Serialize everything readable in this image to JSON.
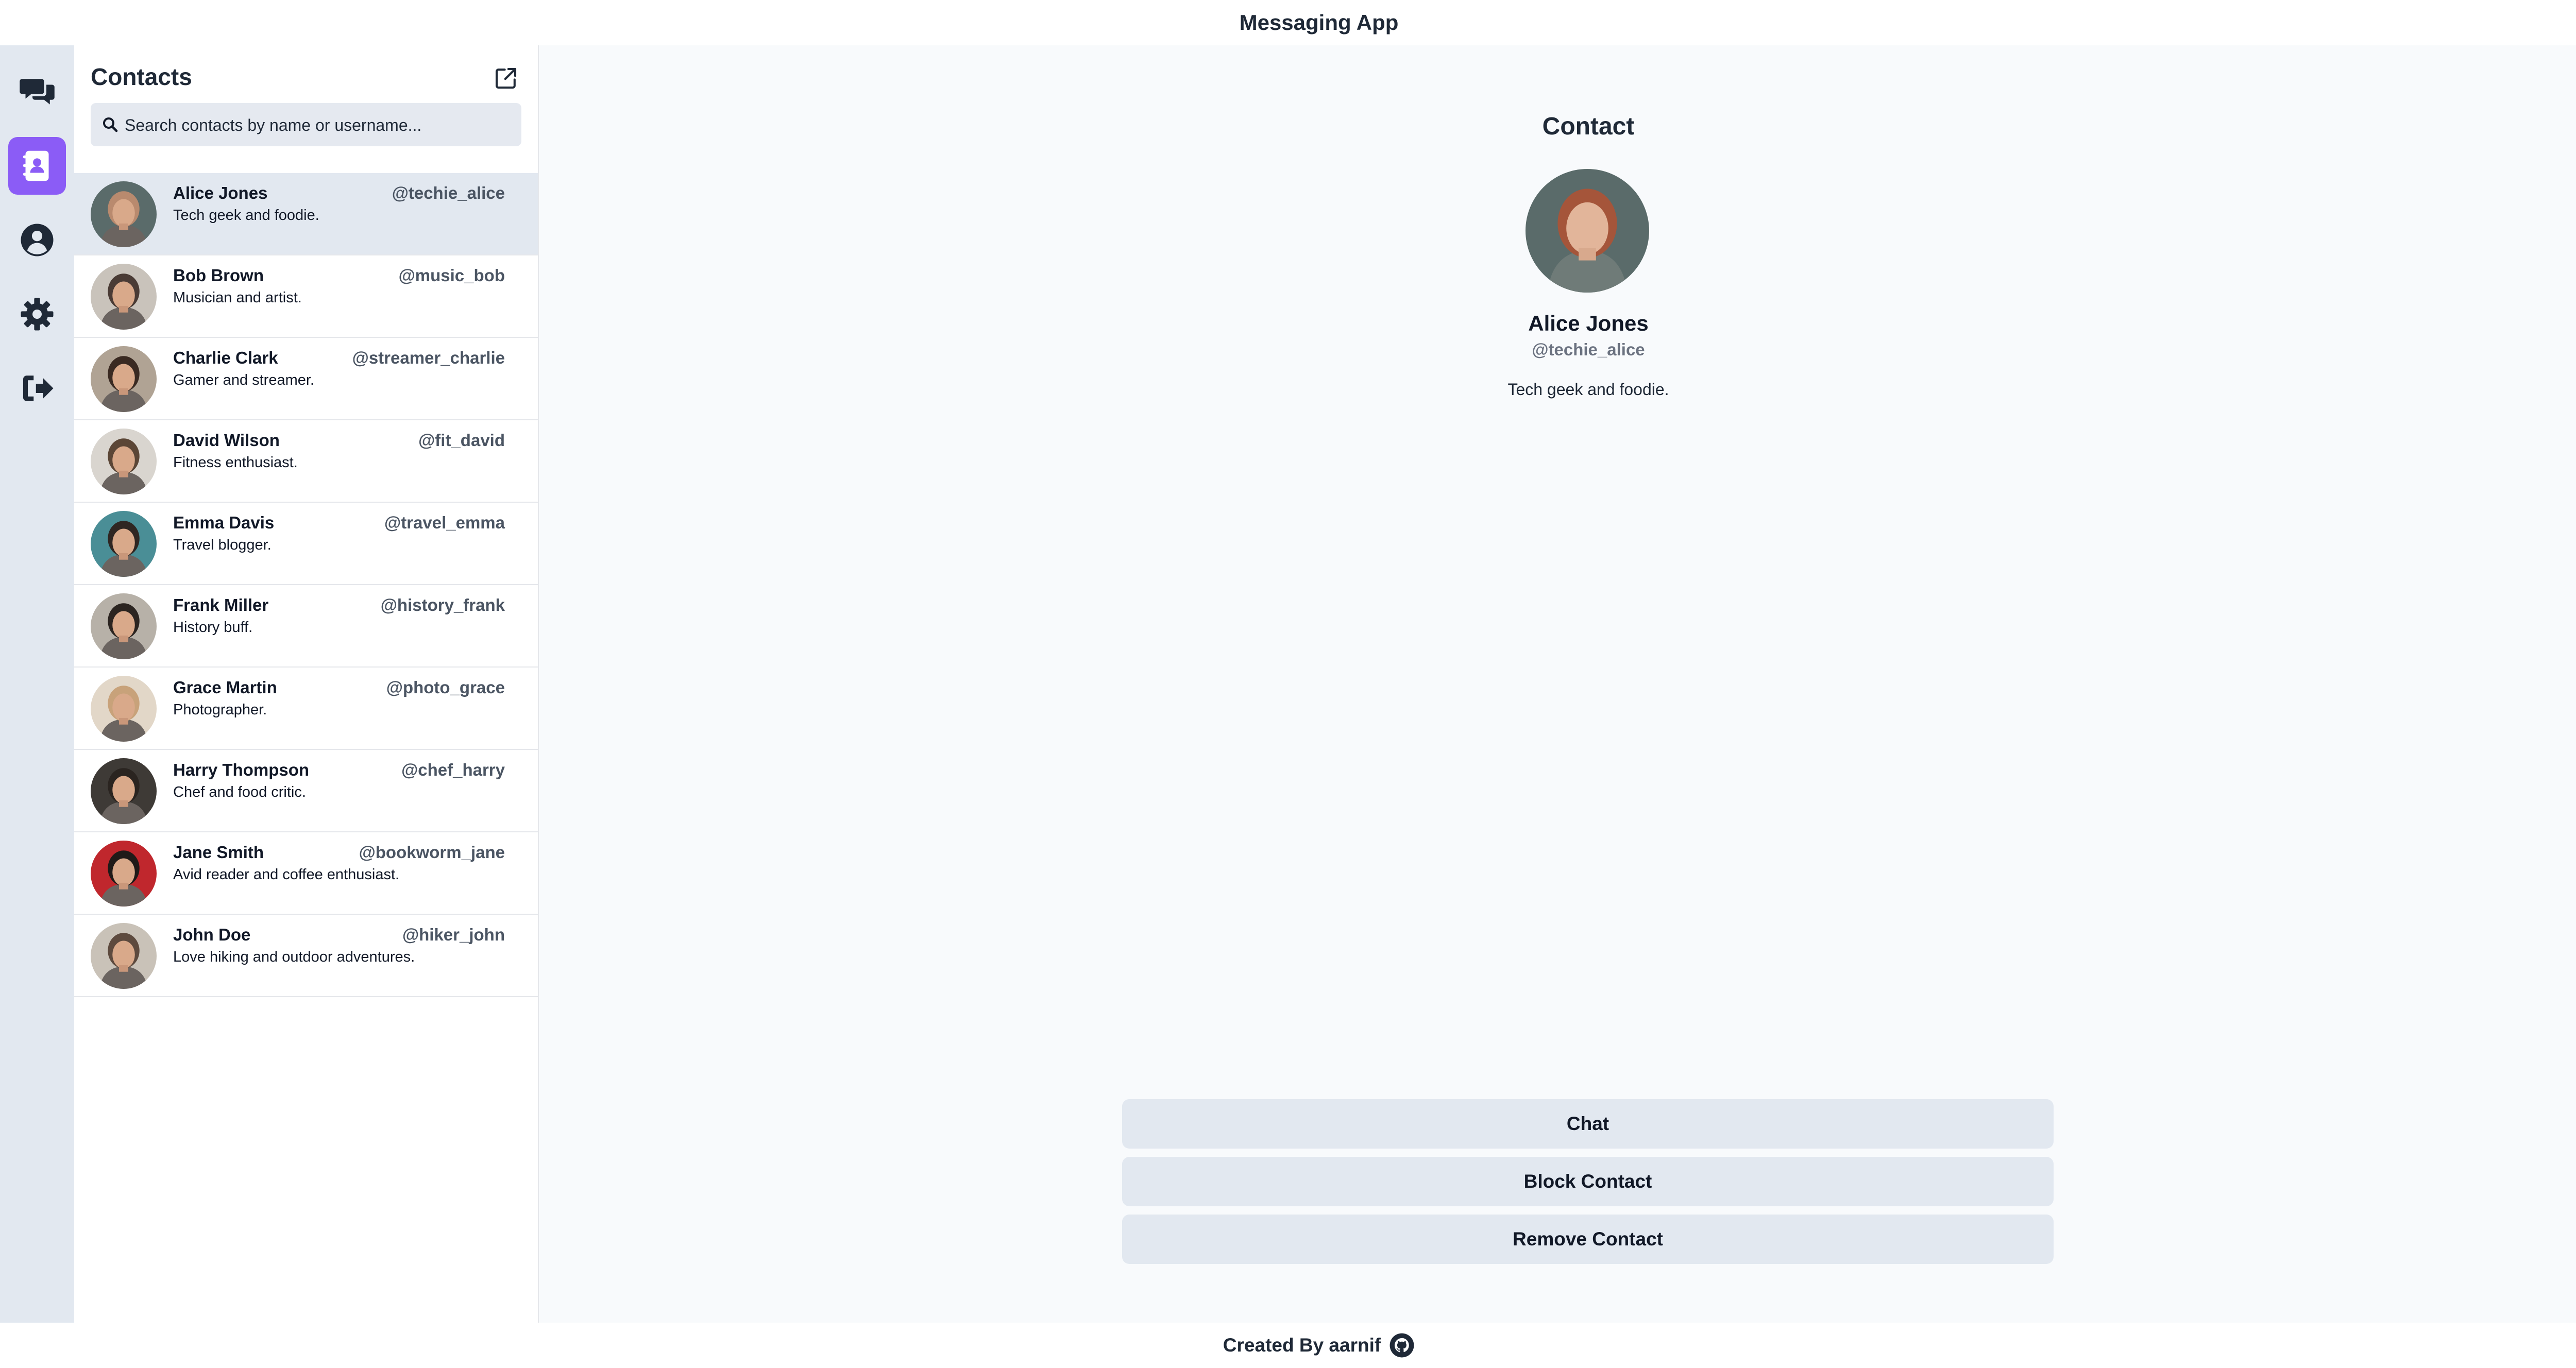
{
  "app": {
    "title": "Messaging App"
  },
  "rail": {
    "items": [
      {
        "icon": "chats-icon",
        "active": false
      },
      {
        "icon": "contacts-book-icon",
        "active": true
      },
      {
        "icon": "user-circle-icon",
        "active": false
      },
      {
        "icon": "gear-icon",
        "active": false
      },
      {
        "icon": "sign-out-icon",
        "active": false
      }
    ],
    "accent": "#8b5cf6"
  },
  "sidebar": {
    "title": "Contacts",
    "new_icon": "external-link-icon",
    "search": {
      "placeholder": "Search contacts by name or username...",
      "value": ""
    }
  },
  "contacts": [
    {
      "name": "Alice Jones",
      "username": "@techie_alice",
      "bio": "Tech geek and foodie.",
      "selected": true,
      "avatar_colors": [
        "#b98a6e",
        "#5a6b6a"
      ]
    },
    {
      "name": "Bob Brown",
      "username": "@music_bob",
      "bio": "Musician and artist.",
      "selected": false,
      "avatar_colors": [
        "#4a3b35",
        "#c9c3bb"
      ]
    },
    {
      "name": "Charlie Clark",
      "username": "@streamer_charlie",
      "bio": "Gamer and streamer.",
      "selected": false,
      "avatar_colors": [
        "#3a2a22",
        "#b0a394"
      ]
    },
    {
      "name": "David Wilson",
      "username": "@fit_david",
      "bio": "Fitness enthusiast.",
      "selected": false,
      "avatar_colors": [
        "#5b4636",
        "#d9d5cf"
      ]
    },
    {
      "name": "Emma Davis",
      "username": "@travel_emma",
      "bio": "Travel blogger.",
      "selected": false,
      "avatar_colors": [
        "#2f2622",
        "#4a8e96"
      ]
    },
    {
      "name": "Frank Miller",
      "username": "@history_frank",
      "bio": "History buff.",
      "selected": false,
      "avatar_colors": [
        "#2b2420",
        "#b7b1a8"
      ]
    },
    {
      "name": "Grace Martin",
      "username": "@photo_grace",
      "bio": "Photographer.",
      "selected": false,
      "avatar_colors": [
        "#c8a27a",
        "#e2d7c8"
      ]
    },
    {
      "name": "Harry Thompson",
      "username": "@chef_harry",
      "bio": "Chef and food critic.",
      "selected": false,
      "avatar_colors": [
        "#2a2420",
        "#3e3a36"
      ]
    },
    {
      "name": "Jane Smith",
      "username": "@bookworm_jane",
      "bio": "Avid reader and coffee enthusiast.",
      "selected": false,
      "avatar_colors": [
        "#1f1a18",
        "#c0272d"
      ]
    },
    {
      "name": "John Doe",
      "username": "@hiker_john",
      "bio": "Love hiking and outdoor adventures.",
      "selected": false,
      "avatar_colors": [
        "#5d4a3e",
        "#c9c2b8"
      ]
    }
  ],
  "detail": {
    "heading": "Contact",
    "name": "Alice Jones",
    "username": "@techie_alice",
    "bio": "Tech geek and foodie.",
    "actions": {
      "chat": "Chat",
      "block": "Block Contact",
      "remove": "Remove Contact"
    }
  },
  "footer": {
    "text": "Created By aarnif",
    "icon": "github-icon"
  }
}
